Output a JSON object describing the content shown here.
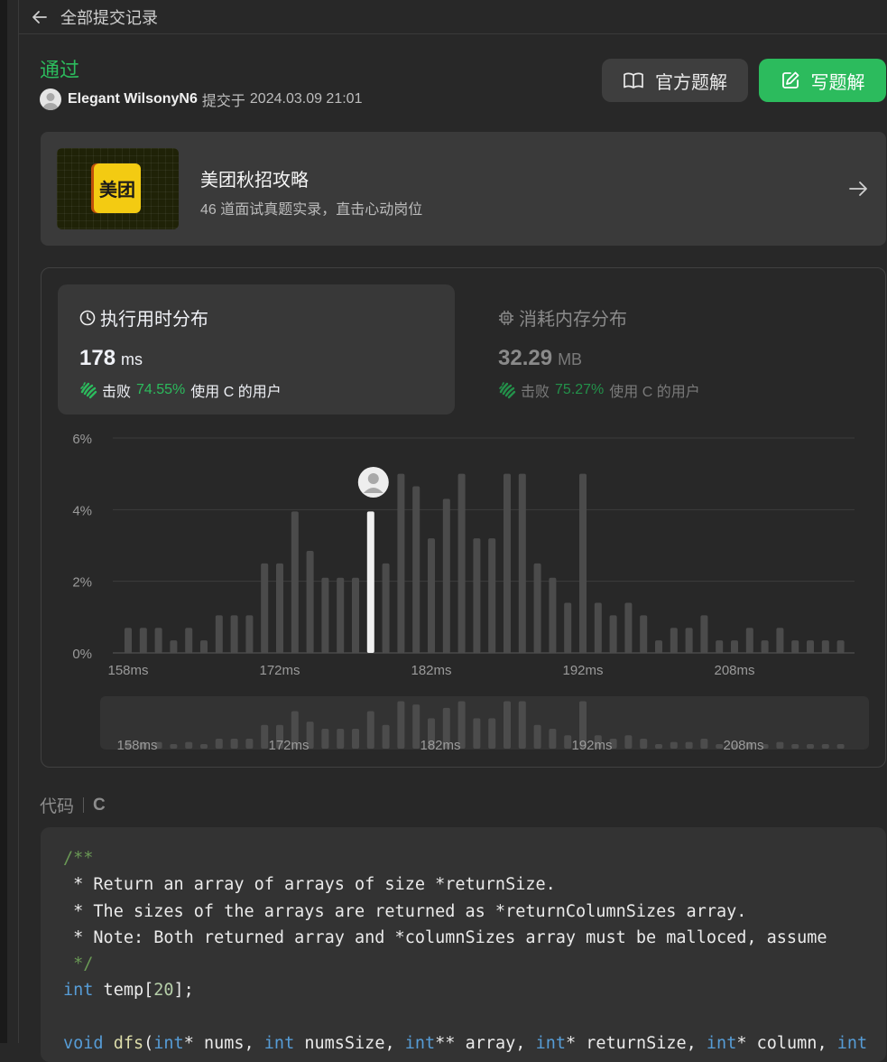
{
  "header": {
    "title": "全部提交记录"
  },
  "submission": {
    "status": "通过",
    "user": "Elegant WilsonyN6",
    "submitted_prefix": "提交于",
    "time": "2024.03.09 21:01"
  },
  "buttons": {
    "official": "官方题解",
    "write": "写题解"
  },
  "banner": {
    "logo_text": "美团",
    "title": "美团秋招攻略",
    "subtitle": "46 道面试真题实录，直击心动岗位"
  },
  "runtime": {
    "label": "执行用时分布",
    "value": "178",
    "unit": "ms",
    "beat_prefix": "击败",
    "beat_pct": "74.55%",
    "beat_suffix": "使用 C 的用户"
  },
  "memory": {
    "label": "消耗内存分布",
    "value": "32.29",
    "unit": "MB",
    "beat_prefix": "击败",
    "beat_pct": "75.27%",
    "beat_suffix": "使用 C 的用户"
  },
  "chart_data": {
    "type": "bar",
    "y_ticks": [
      "6%",
      "4%",
      "2%",
      "0%"
    ],
    "x_ticks": [
      "158ms",
      "172ms",
      "182ms",
      "192ms",
      "208ms"
    ],
    "ylim": [
      0,
      6
    ],
    "values": [
      0.7,
      0.7,
      0.7,
      0.35,
      0.7,
      0.35,
      1.05,
      1.05,
      1.05,
      2.5,
      2.5,
      3.95,
      2.85,
      2.1,
      2.1,
      2.1,
      3.95,
      2.5,
      5.0,
      4.65,
      3.2,
      4.3,
      5.0,
      3.2,
      3.2,
      5.0,
      5.0,
      2.5,
      2.1,
      1.4,
      5.0,
      1.4,
      1.05,
      1.4,
      1.05,
      0.35,
      0.7,
      0.7,
      1.05,
      0.35,
      0.35,
      0.7,
      0.35,
      0.7,
      0.35,
      0.35,
      0.35,
      0.35
    ],
    "highlight_index": 16,
    "bar_color": "#4b4b4b",
    "highlight_color": "#f0f0f0"
  },
  "code": {
    "label": "代码",
    "lang": "C",
    "lines": [
      [
        [
          "c",
          "/**"
        ]
      ],
      [
        [
          "p",
          " * Return an array of arrays of size *returnSize."
        ]
      ],
      [
        [
          "p",
          " * The sizes of the arrays are returned as *returnColumnSizes array."
        ]
      ],
      [
        [
          "p",
          " * Note: Both returned array and *columnSizes array must be malloced, assume"
        ]
      ],
      [
        [
          "c",
          " */"
        ]
      ],
      [
        [
          "k",
          "int"
        ],
        [
          "p",
          " temp["
        ],
        [
          "n",
          "20"
        ],
        [
          "p",
          "];"
        ]
      ],
      [
        [
          "p",
          ""
        ]
      ],
      [
        [
          "k",
          "void"
        ],
        [
          "p",
          " "
        ],
        [
          "f",
          "dfs"
        ],
        [
          "p",
          "("
        ],
        [
          "k",
          "int"
        ],
        [
          "p",
          "* nums, "
        ],
        [
          "k",
          "int"
        ],
        [
          "p",
          " numsSize, "
        ],
        [
          "k",
          "int"
        ],
        [
          "p",
          "** array, "
        ],
        [
          "k",
          "int"
        ],
        [
          "p",
          "* returnSize, "
        ],
        [
          "k",
          "int"
        ],
        [
          "p",
          "* column, "
        ],
        [
          "k",
          "int"
        ]
      ]
    ]
  },
  "colors": {
    "accent": "#2cbb5d",
    "comment": "#6a9955",
    "keyword": "#569cd6",
    "number": "#b5cea8",
    "function": "#dcdcaa"
  }
}
